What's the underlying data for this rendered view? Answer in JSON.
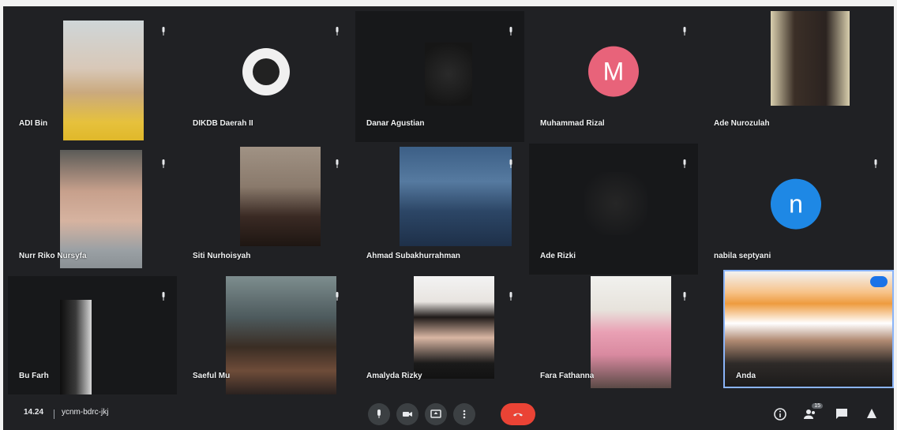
{
  "participants": [
    {
      "name": "ADI Bin"
    },
    {
      "name": "DIKDB Daerah II"
    },
    {
      "name": "Danar Agustian"
    },
    {
      "name": "Muhammad Rizal"
    },
    {
      "name": "Ade Nurozulah"
    },
    {
      "name": "Nurr Riko Nursyfa"
    },
    {
      "name": "Siti Nurhoisyah"
    },
    {
      "name": "Ahmad Subakhurrahman"
    },
    {
      "name": "Ade Rizki"
    },
    {
      "name": "nabila septyani"
    },
    {
      "name": "Bu Farh"
    },
    {
      "name": "Saeful Mu"
    },
    {
      "name": "Amalyda Rizky"
    },
    {
      "name": "Fara Fathanna"
    },
    {
      "name": "Anda"
    }
  ],
  "avatars": {
    "muhammad": {
      "letter": "M",
      "color": "#e8637a"
    },
    "nabila": {
      "letter": "n",
      "color": "#1e88e5"
    }
  },
  "bottom_bar": {
    "time": "14.24",
    "meeting_code": "ycnm-bdrc-jkj"
  },
  "icons": {
    "mic": "mic-icon",
    "camera": "camera-icon",
    "present": "present-screen-icon",
    "more": "more-options-icon",
    "end": "end-call-icon",
    "info": "info-icon",
    "people": "people-icon",
    "chat": "chat-icon",
    "activities": "activities-icon"
  },
  "people_count": "15"
}
